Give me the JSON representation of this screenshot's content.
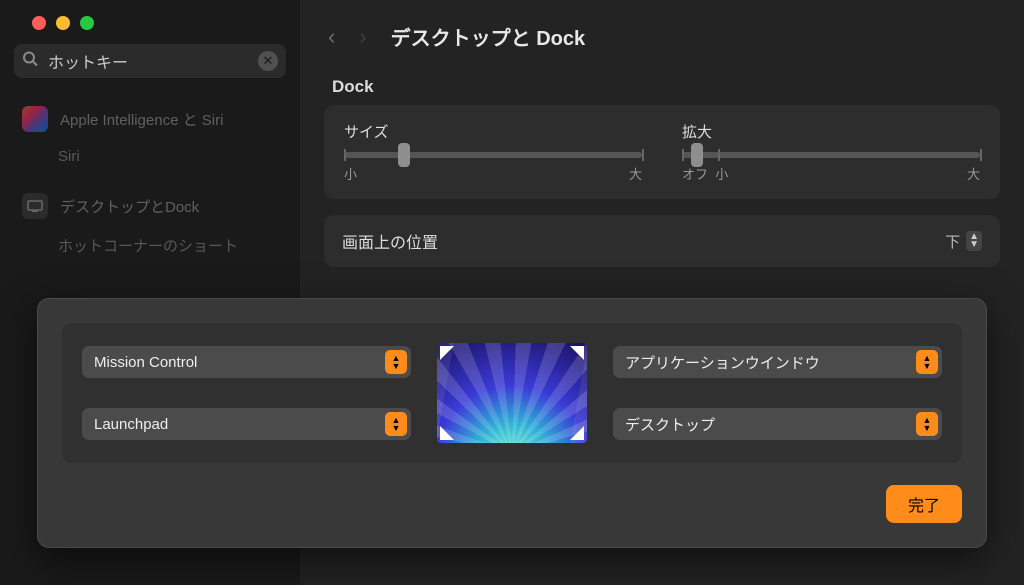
{
  "titlebar": {},
  "search": {
    "value": "ホットキー"
  },
  "sidebar": {
    "items": [
      {
        "icon": "siri",
        "label": "Apple Intelligence と Siri"
      },
      {
        "sublabel": "Siri"
      },
      {
        "icon": "desktop",
        "label": "デスクトップとDock"
      },
      {
        "sublabel": "ホットコーナーのショート"
      }
    ]
  },
  "header": {
    "title": "デスクトップと Dock"
  },
  "dock": {
    "section_label": "Dock",
    "size": {
      "label": "サイズ",
      "min_label": "小",
      "max_label": "大",
      "value_pct": 20
    },
    "magnification": {
      "label": "拡大",
      "off_label": "オフ",
      "min_label": "小",
      "max_label": "大",
      "value_pct": 5
    }
  },
  "position": {
    "label": "画面上の位置",
    "value": "下"
  },
  "hotcorners": {
    "top_left": "Mission Control",
    "top_right": "アプリケーションウインドウ",
    "bottom_left": "Launchpad",
    "bottom_right": "デスクトップ",
    "done_label": "完了"
  }
}
